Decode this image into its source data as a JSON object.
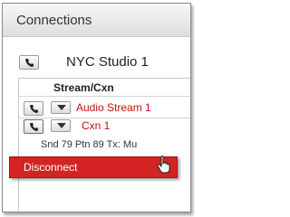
{
  "header": {
    "title": "Connections"
  },
  "studio": {
    "name": "NYC Studio 1"
  },
  "table": {
    "column_header": "Stream/Cxn",
    "stream_label": "Audio Stream 1",
    "connection_label": "Cxn 1",
    "info_text": "Snd 79 Ptn 89  Tx: Mu"
  },
  "menu": {
    "disconnect_label": "Disconnect"
  },
  "colors": {
    "accent_red": "#d32323",
    "text_red": "#c01010"
  }
}
